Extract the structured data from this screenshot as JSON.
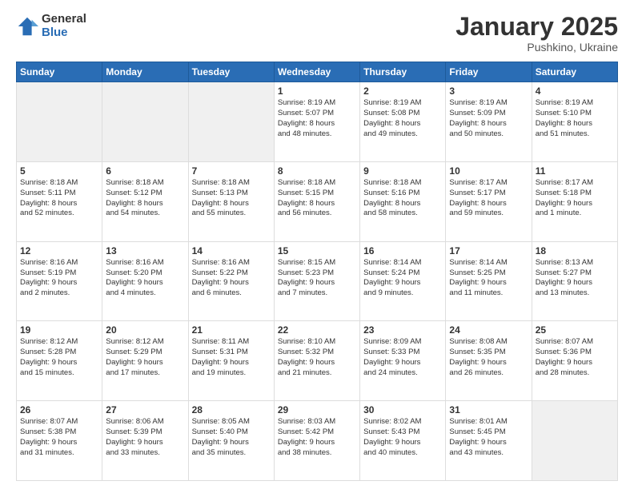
{
  "logo": {
    "general": "General",
    "blue": "Blue"
  },
  "title": "January 2025",
  "subtitle": "Pushkino, Ukraine",
  "weekdays": [
    "Sunday",
    "Monday",
    "Tuesday",
    "Wednesday",
    "Thursday",
    "Friday",
    "Saturday"
  ],
  "weeks": [
    [
      {
        "day": "",
        "info": "",
        "empty": true
      },
      {
        "day": "",
        "info": "",
        "empty": true
      },
      {
        "day": "",
        "info": "",
        "empty": true
      },
      {
        "day": "1",
        "info": "Sunrise: 8:19 AM\nSunset: 5:07 PM\nDaylight: 8 hours\nand 48 minutes."
      },
      {
        "day": "2",
        "info": "Sunrise: 8:19 AM\nSunset: 5:08 PM\nDaylight: 8 hours\nand 49 minutes."
      },
      {
        "day": "3",
        "info": "Sunrise: 8:19 AM\nSunset: 5:09 PM\nDaylight: 8 hours\nand 50 minutes."
      },
      {
        "day": "4",
        "info": "Sunrise: 8:19 AM\nSunset: 5:10 PM\nDaylight: 8 hours\nand 51 minutes."
      }
    ],
    [
      {
        "day": "5",
        "info": "Sunrise: 8:18 AM\nSunset: 5:11 PM\nDaylight: 8 hours\nand 52 minutes."
      },
      {
        "day": "6",
        "info": "Sunrise: 8:18 AM\nSunset: 5:12 PM\nDaylight: 8 hours\nand 54 minutes."
      },
      {
        "day": "7",
        "info": "Sunrise: 8:18 AM\nSunset: 5:13 PM\nDaylight: 8 hours\nand 55 minutes."
      },
      {
        "day": "8",
        "info": "Sunrise: 8:18 AM\nSunset: 5:15 PM\nDaylight: 8 hours\nand 56 minutes."
      },
      {
        "day": "9",
        "info": "Sunrise: 8:18 AM\nSunset: 5:16 PM\nDaylight: 8 hours\nand 58 minutes."
      },
      {
        "day": "10",
        "info": "Sunrise: 8:17 AM\nSunset: 5:17 PM\nDaylight: 8 hours\nand 59 minutes."
      },
      {
        "day": "11",
        "info": "Sunrise: 8:17 AM\nSunset: 5:18 PM\nDaylight: 9 hours\nand 1 minute."
      }
    ],
    [
      {
        "day": "12",
        "info": "Sunrise: 8:16 AM\nSunset: 5:19 PM\nDaylight: 9 hours\nand 2 minutes."
      },
      {
        "day": "13",
        "info": "Sunrise: 8:16 AM\nSunset: 5:20 PM\nDaylight: 9 hours\nand 4 minutes."
      },
      {
        "day": "14",
        "info": "Sunrise: 8:16 AM\nSunset: 5:22 PM\nDaylight: 9 hours\nand 6 minutes."
      },
      {
        "day": "15",
        "info": "Sunrise: 8:15 AM\nSunset: 5:23 PM\nDaylight: 9 hours\nand 7 minutes."
      },
      {
        "day": "16",
        "info": "Sunrise: 8:14 AM\nSunset: 5:24 PM\nDaylight: 9 hours\nand 9 minutes."
      },
      {
        "day": "17",
        "info": "Sunrise: 8:14 AM\nSunset: 5:25 PM\nDaylight: 9 hours\nand 11 minutes."
      },
      {
        "day": "18",
        "info": "Sunrise: 8:13 AM\nSunset: 5:27 PM\nDaylight: 9 hours\nand 13 minutes."
      }
    ],
    [
      {
        "day": "19",
        "info": "Sunrise: 8:12 AM\nSunset: 5:28 PM\nDaylight: 9 hours\nand 15 minutes."
      },
      {
        "day": "20",
        "info": "Sunrise: 8:12 AM\nSunset: 5:29 PM\nDaylight: 9 hours\nand 17 minutes."
      },
      {
        "day": "21",
        "info": "Sunrise: 8:11 AM\nSunset: 5:31 PM\nDaylight: 9 hours\nand 19 minutes."
      },
      {
        "day": "22",
        "info": "Sunrise: 8:10 AM\nSunset: 5:32 PM\nDaylight: 9 hours\nand 21 minutes."
      },
      {
        "day": "23",
        "info": "Sunrise: 8:09 AM\nSunset: 5:33 PM\nDaylight: 9 hours\nand 24 minutes."
      },
      {
        "day": "24",
        "info": "Sunrise: 8:08 AM\nSunset: 5:35 PM\nDaylight: 9 hours\nand 26 minutes."
      },
      {
        "day": "25",
        "info": "Sunrise: 8:07 AM\nSunset: 5:36 PM\nDaylight: 9 hours\nand 28 minutes."
      }
    ],
    [
      {
        "day": "26",
        "info": "Sunrise: 8:07 AM\nSunset: 5:38 PM\nDaylight: 9 hours\nand 31 minutes."
      },
      {
        "day": "27",
        "info": "Sunrise: 8:06 AM\nSunset: 5:39 PM\nDaylight: 9 hours\nand 33 minutes."
      },
      {
        "day": "28",
        "info": "Sunrise: 8:05 AM\nSunset: 5:40 PM\nDaylight: 9 hours\nand 35 minutes."
      },
      {
        "day": "29",
        "info": "Sunrise: 8:03 AM\nSunset: 5:42 PM\nDaylight: 9 hours\nand 38 minutes."
      },
      {
        "day": "30",
        "info": "Sunrise: 8:02 AM\nSunset: 5:43 PM\nDaylight: 9 hours\nand 40 minutes."
      },
      {
        "day": "31",
        "info": "Sunrise: 8:01 AM\nSunset: 5:45 PM\nDaylight: 9 hours\nand 43 minutes."
      },
      {
        "day": "",
        "info": "",
        "empty": true
      }
    ]
  ]
}
